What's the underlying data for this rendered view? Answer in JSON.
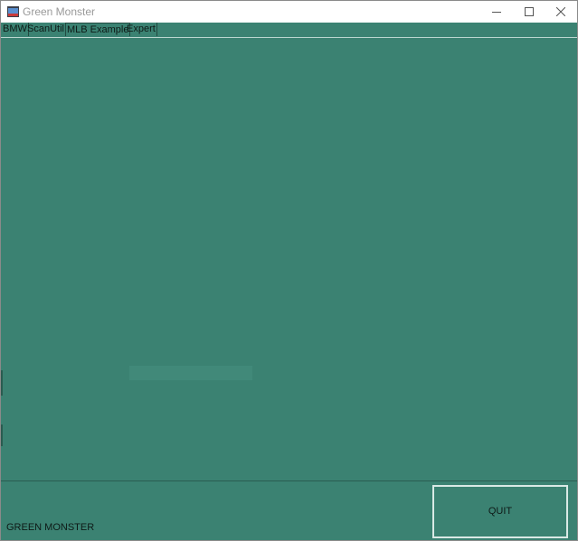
{
  "window": {
    "title": "Green Monster",
    "controls": [
      "minimize-icon",
      "maximize-icon",
      "close-icon"
    ]
  },
  "tabs": [
    {
      "label": "BMW",
      "active": false
    },
    {
      "label": "ScanUtil",
      "active": false
    },
    {
      "label": "MLB Example",
      "active": true
    },
    {
      "label": "Expert",
      "active": false
    }
  ],
  "footer": {
    "status_label": "GREEN MONSTER",
    "quit_label": "QUIT"
  },
  "colors": {
    "background": "#3b8272",
    "titlebar": "#ffffff",
    "text": "#0e1a17",
    "quit_border": "#d9e9e5"
  }
}
